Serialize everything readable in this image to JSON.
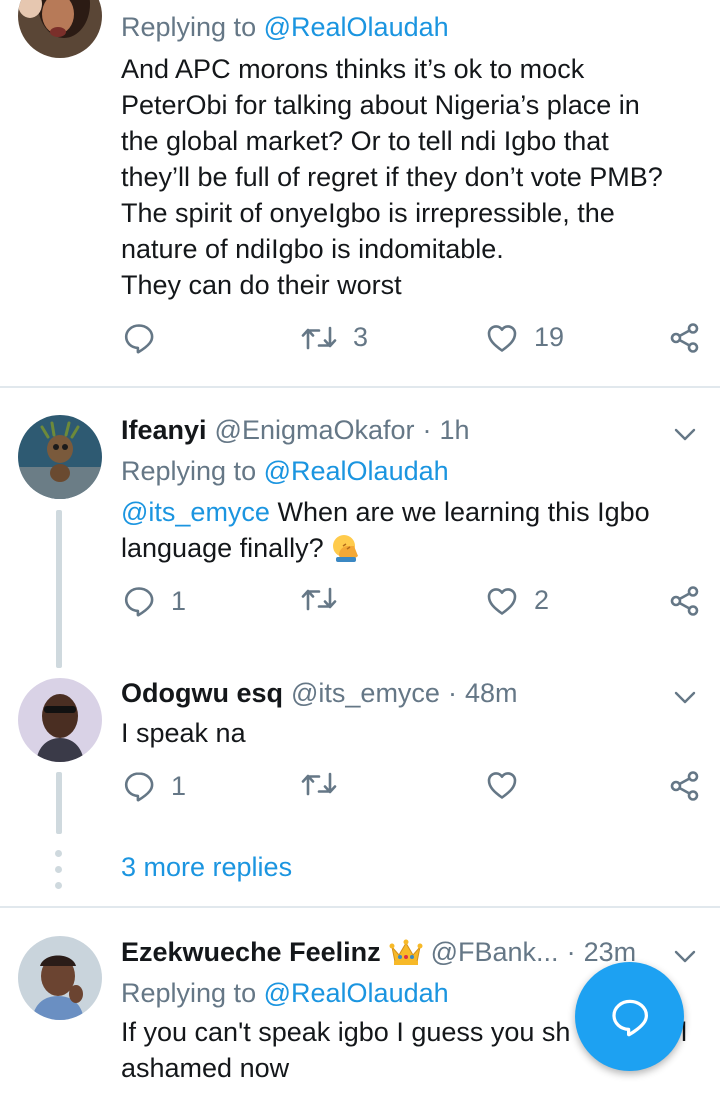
{
  "tweet1": {
    "replying_prefix": "Replying to",
    "replying_to": "@RealOlaudah",
    "lines": [
      "And APC morons thinks it’s ok to mock",
      "PeterObi for talking about Nigeria’s place in",
      "the global market? Or to tell ndi Igbo that",
      "they’ll be full of regret if they don’t vote PMB?",
      "The spirit of onyeIgbo is irrepressible, the",
      "nature of ndiIgbo is indomitable.",
      "They can do their worst"
    ],
    "reply_count": "",
    "retweet_count": "3",
    "like_count": "19"
  },
  "tweet2": {
    "name": "Ifeanyi",
    "handle": "@EnigmaOkafor",
    "separator": "·",
    "time": "1h",
    "replying_prefix": "Replying to",
    "replying_to": "@RealOlaudah",
    "mention": "@its_emyce",
    "line1_rest": " When are we learning this Igbo",
    "line2": "language finally? ",
    "reply_count": "1",
    "retweet_count": "",
    "like_count": "2"
  },
  "tweet3": {
    "name": "Odogwu esq",
    "handle": "@its_emyce",
    "separator": "·",
    "time": "48m",
    "text": "I speak na",
    "reply_count": "1",
    "retweet_count": "",
    "like_count": ""
  },
  "more_replies": "3 more replies",
  "tweet4": {
    "name": "Ezekwueche Feelinz",
    "handle": "@FBank...",
    "separator": "·",
    "time": "23m",
    "replying_prefix": "Replying to",
    "replying_to": "@RealOlaudah",
    "line1": "If you can't speak igbo I guess you sh",
    "line1_tail": "l",
    "line2": "ashamed now"
  },
  "colors": {
    "accent": "#1b95e0",
    "fab": "#1da1f2",
    "muted": "#657786"
  },
  "icons": {
    "reply": "reply-icon",
    "retweet": "retweet-icon",
    "like": "heart-icon",
    "share": "share-icon",
    "more": "chevron-down-icon",
    "compose": "compose-reply-icon",
    "crown": "crown-emoji-icon",
    "facepalm": "facepalm-emoji-icon"
  }
}
